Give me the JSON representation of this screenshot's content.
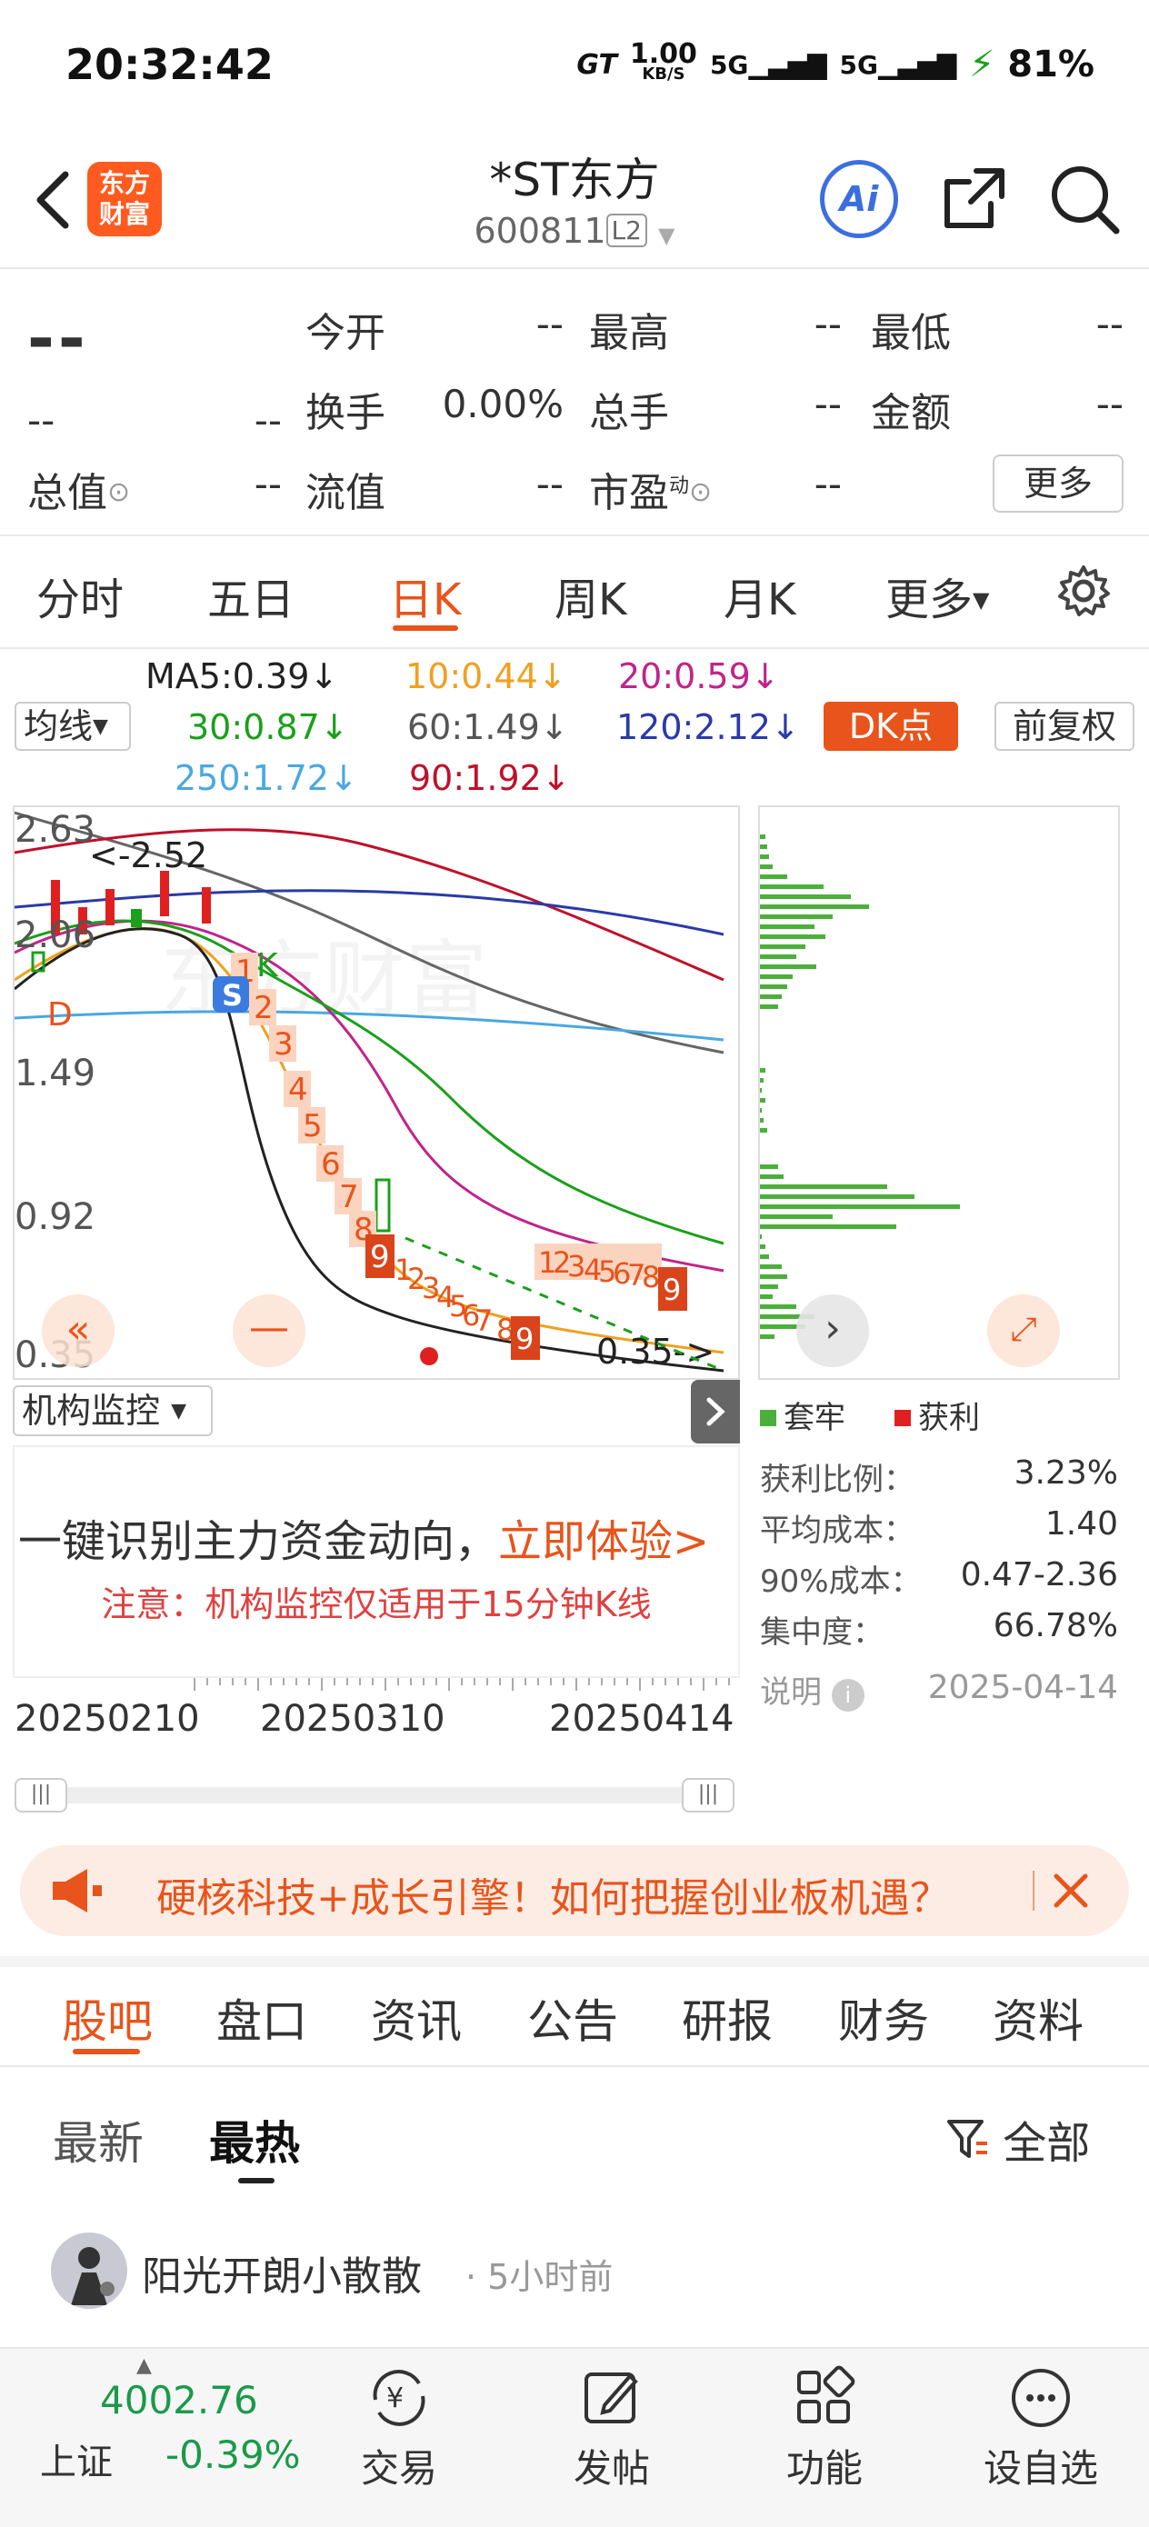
{
  "status_bar": {
    "time": "20:32:42",
    "net_speed": "1.00",
    "net_unit": "KB/S",
    "signal1": "5G",
    "signal2": "5G",
    "battery": "81%"
  },
  "header": {
    "logo_line1": "东方",
    "logo_line2": "财富",
    "stock_name": "*ST东方",
    "stock_code": "600811",
    "level_badge": "L2",
    "ai_label": "Ai"
  },
  "quote": {
    "price": "--",
    "change1": "--",
    "change2": "--",
    "rows": [
      [
        {
          "label": "今开",
          "value": "--"
        },
        {
          "label": "最高",
          "value": "--"
        },
        {
          "label": "最低",
          "value": "--"
        }
      ],
      [
        {
          "label": "换手",
          "value": "0.00%"
        },
        {
          "label": "总手",
          "value": "--"
        },
        {
          "label": "金额",
          "value": "--"
        }
      ]
    ],
    "total_value_label": "总值",
    "total_value": "--",
    "float_value_label": "流值",
    "float_value": "--",
    "pe_label": "市盈",
    "pe_sup": "动",
    "pe_value": "--",
    "more_button": "更多"
  },
  "period_tabs": [
    "分时",
    "五日",
    "日K",
    "周K",
    "月K",
    "更多"
  ],
  "active_period": "日K",
  "ma_legend": {
    "ma5": "MA5:0.39↓",
    "ma10": "10:0.44↓",
    "ma20": "20:0.59↓",
    "ma30": "30:0.87↓",
    "ma60": "60:1.49↓",
    "ma120": "120:2.12↓",
    "ma250": "250:1.72↓",
    "ma90": "90:1.92↓",
    "indicator_button": "均线",
    "dk_button": "DK点",
    "adjust_button": "前复权",
    "colors": {
      "ma5": "#222222",
      "ma10": "#f0a020",
      "ma20": "#c0248a",
      "ma30": "#1aa01a",
      "ma60": "#666666",
      "ma120": "#2a3aa8",
      "ma250": "#4aa8e0",
      "ma90": "#c0102a"
    }
  },
  "chart_data": {
    "type": "candlestick",
    "y_ticks": [
      "2.63",
      "2.06",
      "1.49",
      "0.92",
      "0.35"
    ],
    "annotations": {
      "high_marker": "<-2.52",
      "low_marker": "0.35->",
      "signal_d": "D",
      "signal_k": "K",
      "signal_s": "S"
    },
    "countdown_first": [
      "1",
      "2",
      "3",
      "4",
      "5",
      "6",
      "7",
      "8",
      "9"
    ],
    "countdown_second": [
      "1",
      "2",
      "3",
      "4",
      "5",
      "6",
      "7",
      "8",
      "9"
    ],
    "countdown_third": [
      "1",
      "2",
      "3",
      "4",
      "5",
      "6",
      "7",
      "8",
      "9"
    ],
    "x_dates": [
      "20250210",
      "20250310",
      "20250414"
    ]
  },
  "chip_panel": {
    "legend_trapped": "套牢",
    "legend_profit": "获利",
    "stats": [
      {
        "label": "获利比例：",
        "value": "3.23%"
      },
      {
        "label": "平均成本：",
        "value": "1.40"
      },
      {
        "label": "90%成本：",
        "value": "0.47-2.36"
      },
      {
        "label": "集中度：",
        "value": "66.78%"
      }
    ],
    "note_label": "说明",
    "date": "2025-04-14"
  },
  "institution": {
    "dropdown": "机构监控",
    "main_text": "一键识别主力资金动向，",
    "cta": "立即体验>",
    "note": "注意：机构监控仅适用于15分钟K线"
  },
  "banner": {
    "text": "硬核科技+成长引擎！如何把握创业板机遇？"
  },
  "content_tabs": [
    "股吧",
    "盘口",
    "资讯",
    "公告",
    "研报",
    "财务",
    "资料"
  ],
  "sub_tabs": [
    "最新",
    "最热"
  ],
  "filter_label": "全部",
  "post": {
    "author": "阳光开朗小散散",
    "time": "· 5小时前"
  },
  "bottom_nav": {
    "index_value": "4002.76",
    "index_name": "上证",
    "index_change": "-0.39%",
    "items": [
      "交易",
      "发帖",
      "功能",
      "设自选"
    ]
  }
}
